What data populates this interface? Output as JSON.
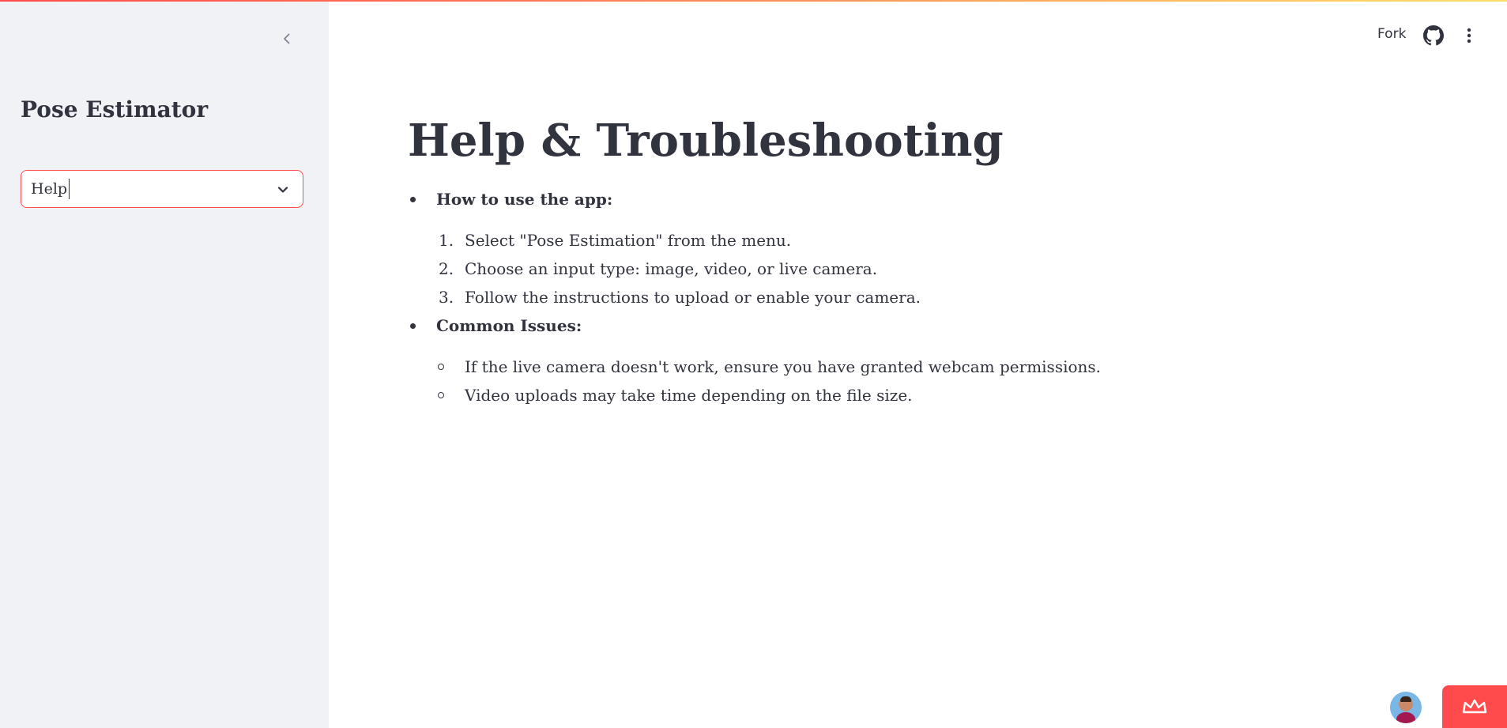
{
  "sidebar": {
    "title": "Pose Estimator",
    "select": {
      "value": "Help"
    }
  },
  "header": {
    "fork_label": "Fork"
  },
  "main": {
    "title": "Help & Troubleshooting",
    "sections": [
      {
        "heading": "How to use the app:",
        "list_type": "ordered",
        "items": [
          {
            "marker": "1.",
            "text": "Select \"Pose Estimation\" from the menu."
          },
          {
            "marker": "2.",
            "text": "Choose an input type: image, video, or live camera."
          },
          {
            "marker": "3.",
            "text": "Follow the instructions to upload or enable your camera."
          }
        ]
      },
      {
        "heading": "Common Issues:",
        "list_type": "unordered",
        "items": [
          {
            "text": "If the live camera doesn't work, ensure you have granted webcam permissions."
          },
          {
            "text": "Video uploads may take time depending on the file size."
          }
        ]
      }
    ]
  },
  "colors": {
    "accent": "#ff4b4b",
    "sidebar_bg": "#f0f2f6",
    "text": "#31333f"
  },
  "icons": [
    "chevron-left-icon",
    "chevron-down-icon",
    "github-icon",
    "kebab-menu-icon",
    "crown-icon"
  ]
}
